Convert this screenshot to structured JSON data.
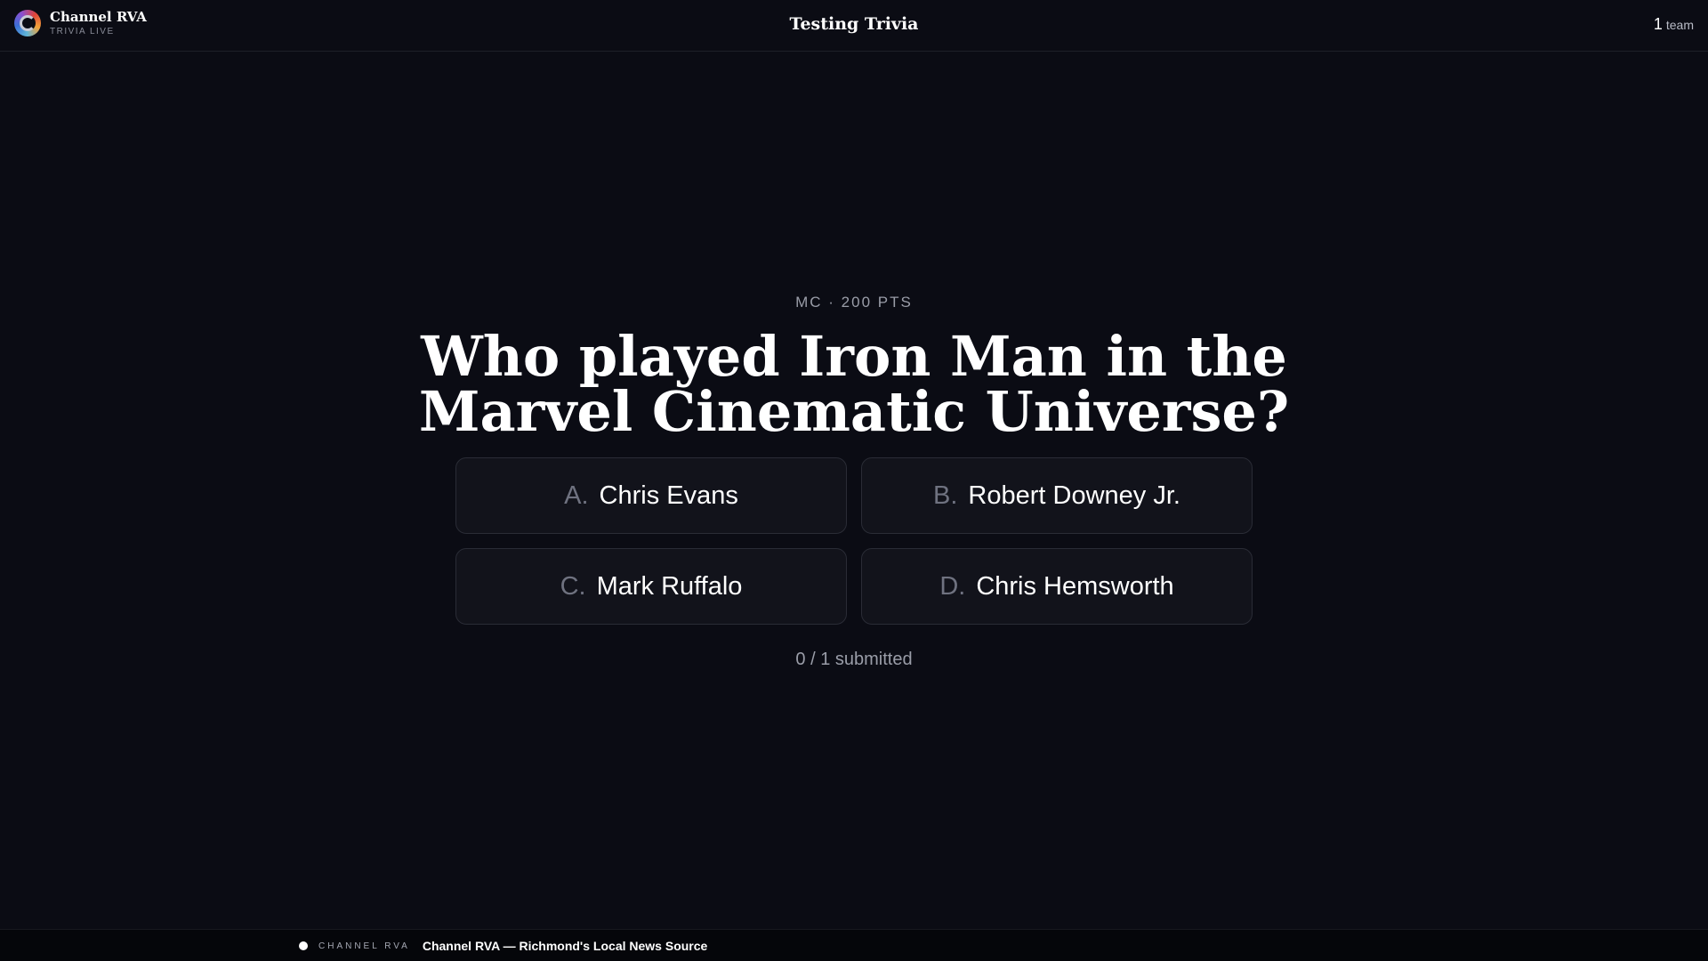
{
  "header": {
    "brand_name": "Channel RVA",
    "brand_sub": "TRIVIA LIVE",
    "title": "Testing Trivia",
    "team_count": "1",
    "team_label": "team"
  },
  "question": {
    "meta": "MC · 200 PTS",
    "text": "Who played Iron Man in the Marvel Cinematic Universe?",
    "answers": [
      {
        "letter": "A.",
        "text": "Chris Evans"
      },
      {
        "letter": "B.",
        "text": "Robert Downey Jr."
      },
      {
        "letter": "C.",
        "text": "Mark Ruffalo"
      },
      {
        "letter": "D.",
        "text": "Chris Hemsworth"
      }
    ],
    "submitted": "0 / 1 submitted"
  },
  "footer": {
    "label": "CHANNEL RVA",
    "text": "Channel RVA — Richmond's Local News Source"
  }
}
